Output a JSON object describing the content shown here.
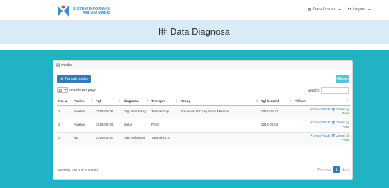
{
  "brand": {
    "line1": "SISTEM INFORMASI",
    "line2": "REKAM MEDIS"
  },
  "nav": {
    "dokter": "Data Dokter",
    "logout": "Logout"
  },
  "page_title": "Data Diagnosa",
  "panel_title": "medis",
  "buttons": {
    "add": "Tambah medis",
    "export": "Eksport"
  },
  "length": {
    "value": "10",
    "label": "records per page"
  },
  "search_label": "Search:",
  "columns": [
    "No.",
    "Pasien",
    "Tgl",
    "Diagnosa",
    "Theraphi",
    "Resep",
    "Tgl kembali",
    "Pilihan"
  ],
  "rows": [
    {
      "no": "1",
      "pasien": "Awalaia",
      "tgl": "2015-05-28",
      "diagnosa": "Gigi Berlubang",
      "theraphi": "Tambal Gigi",
      "resep": "Amoxcilin 500 mg Asam Mafenat...",
      "kembali": "2015-05-31"
    },
    {
      "no": "2",
      "pasien": "Awalaia",
      "tgl": "2015-05-29",
      "diagnosa": "Batuk",
      "theraphi": "Po 6)",
      "resep": "",
      "kembali": "2015-06-02"
    },
    {
      "no": "3",
      "pasien": "Nia",
      "tgl": "2015-05-30",
      "diagnosa": "Gigi berlubang",
      "theraphi": "Tambal Po 5",
      "resep": "",
      "kembali": ""
    }
  ],
  "actions": {
    "detail": "Detail",
    "edit": "Edit",
    "delete": "Delete",
    "print": "Print"
  },
  "info": "Showing 1 to 3 of 3 entries",
  "pager": {
    "prev": "Previous",
    "page": "1",
    "next": "Next"
  },
  "colors": {
    "teal": "#21b2c3",
    "hero": "#d9ebf7",
    "primary": "#337ab7",
    "info": "#5bc0de",
    "print": "#3c9b3c"
  },
  "icons": [
    "logo-icon",
    "table-icon",
    "list-icon",
    "plus-icon",
    "print-icon",
    "search-icon",
    "pencil-icon",
    "trash-icon",
    "user-icon",
    "gear-icon"
  ]
}
